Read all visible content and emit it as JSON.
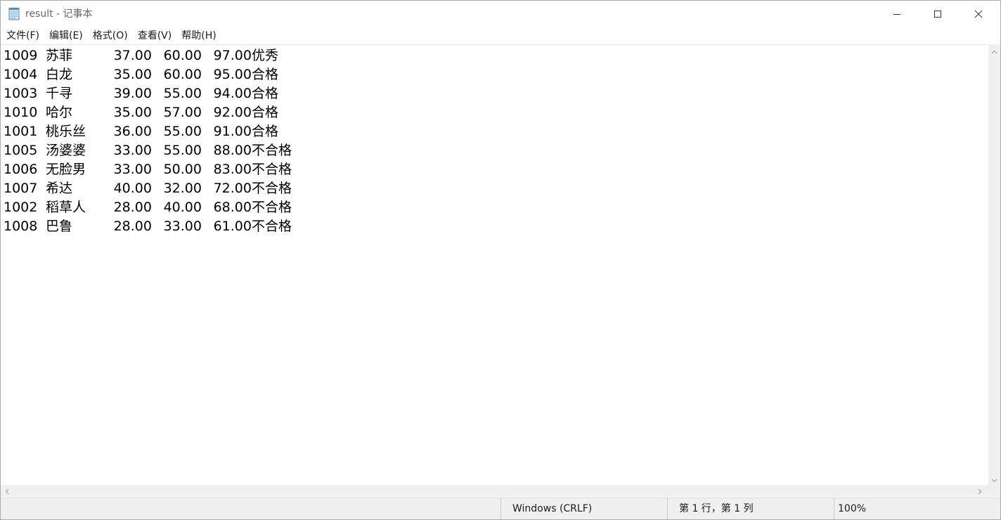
{
  "window": {
    "title": "result - 记事本"
  },
  "menu": {
    "items": [
      "文件(F)",
      "编辑(E)",
      "格式(O)",
      "查看(V)",
      "帮助(H)"
    ]
  },
  "editor": {
    "rows": [
      {
        "id": "1009",
        "name": "苏菲",
        "score1": "37.00",
        "score2": "60.00",
        "total": "97.00",
        "grade": "优秀"
      },
      {
        "id": "1004",
        "name": "白龙",
        "score1": "35.00",
        "score2": "60.00",
        "total": "95.00",
        "grade": "合格"
      },
      {
        "id": "1003",
        "name": "千寻",
        "score1": "39.00",
        "score2": "55.00",
        "total": "94.00",
        "grade": "合格"
      },
      {
        "id": "1010",
        "name": "哈尔",
        "score1": "35.00",
        "score2": "57.00",
        "total": "92.00",
        "grade": "合格"
      },
      {
        "id": "1001",
        "name": "桃乐丝",
        "score1": "36.00",
        "score2": "55.00",
        "total": "91.00",
        "grade": "合格"
      },
      {
        "id": "1005",
        "name": "汤婆婆",
        "score1": "33.00",
        "score2": "55.00",
        "total": "88.00",
        "grade": "不合格"
      },
      {
        "id": "1006",
        "name": "无脸男",
        "score1": "33.00",
        "score2": "50.00",
        "total": "83.00",
        "grade": "不合格"
      },
      {
        "id": "1007",
        "name": "希达",
        "score1": "40.00",
        "score2": "32.00",
        "total": "72.00",
        "grade": "不合格"
      },
      {
        "id": "1002",
        "name": "稻草人",
        "score1": "28.00",
        "score2": "40.00",
        "total": "68.00",
        "grade": "不合格"
      },
      {
        "id": "1008",
        "name": "巴鲁",
        "score1": "28.00",
        "score2": "33.00",
        "total": "61.00",
        "grade": "不合格"
      }
    ]
  },
  "statusbar": {
    "line_ending": "Windows (CRLF)",
    "cursor_position": "第 1 行，第 1 列",
    "zoom": "100%"
  },
  "icons": {
    "app": "notepad-icon",
    "minimize": "minimize-icon",
    "maximize": "maximize-icon",
    "close": "close-icon"
  }
}
